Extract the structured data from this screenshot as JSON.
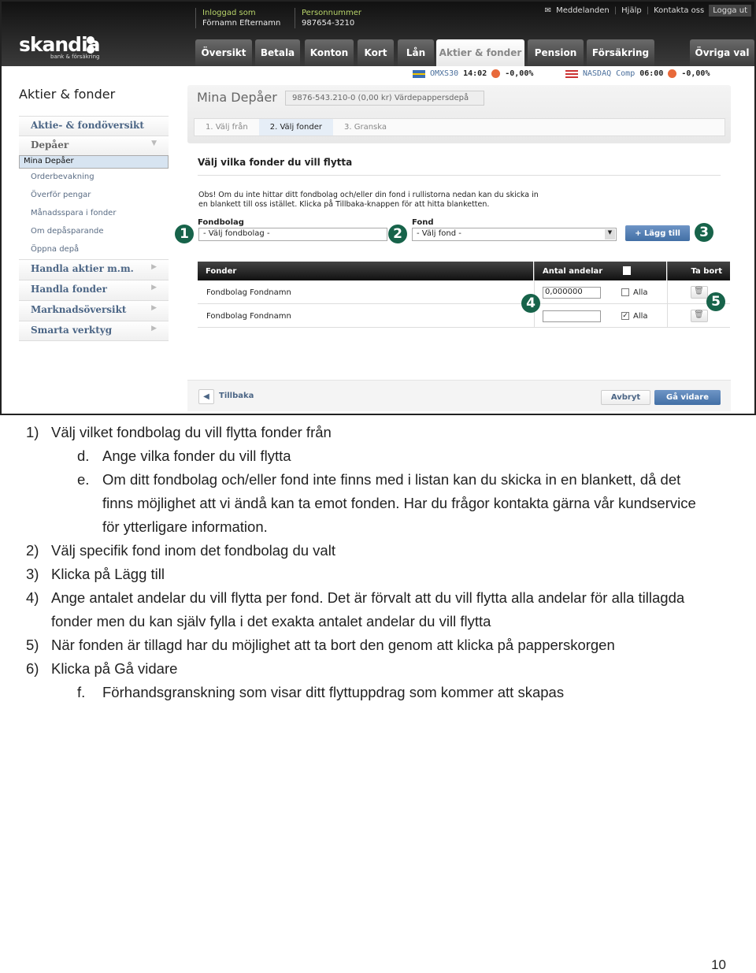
{
  "header": {
    "brand": "skandia",
    "brand_sub": "bank & försäkring",
    "logged_in_label": "Inloggad som",
    "logged_in_name": "Förnamn Efternamn",
    "pnr_label": "Personnummer",
    "pnr_value": "987654-3210",
    "top_links": [
      "Meddelanden",
      "Hjälp",
      "Kontakta oss"
    ],
    "logout": "Logga ut",
    "tabs": [
      "Översikt",
      "Betala",
      "Konton",
      "Kort",
      "Lån",
      "Aktier & fonder",
      "Pension",
      "Försäkring",
      "Övriga val"
    ],
    "active_tab": "Aktier & fonder"
  },
  "ticker": [
    {
      "name": "OMXS30",
      "time": "14:02",
      "change": "-0,00%"
    },
    {
      "name": "NASDAQ Comp",
      "time": "06:00",
      "change": "-0,00%"
    }
  ],
  "sidebar": {
    "title": "Aktier & fonder",
    "overview": "Aktie- & fondöversikt",
    "depaer": "Depåer",
    "sub": [
      "Mina Depåer",
      "Orderbevakning",
      "Överför pengar",
      "Månadsspara i fonder",
      "Om depåsparande",
      "Öppna depå"
    ],
    "sections": [
      "Handla aktier m.m.",
      "Handla fonder",
      "Marknadsöversikt",
      "Smarta verktyg"
    ]
  },
  "main": {
    "title": "Mina Depåer",
    "account": "9876-543.210-0 (0,00 kr) Värdepappersdepå",
    "steps": [
      "1. Välj från",
      "2. Välj fonder",
      "3. Granska"
    ],
    "heading": "Välj vilka fonder du vill flytta",
    "obs_line1": "Obs! Om du inte hittar ditt fondbolag och/eller din fond i rullistorna nedan kan du skicka in",
    "obs_line2": "en blankett till oss istället. Klicka på Tillbaka-knappen för att hitta blanketten.",
    "fondbolag_label": "Fondbolag",
    "fondbolag_value": "- Välj fondbolag -",
    "fond_label": "Fond",
    "fond_value": "- Välj fond -",
    "add": "+  Lägg till",
    "table": {
      "headers": [
        "Fonder",
        "Antal andelar",
        "Ta bort"
      ],
      "rows": [
        {
          "name": "Fondbolag Fondnamn",
          "qty": "0,000000",
          "all": "Alla",
          "all_checked": false
        },
        {
          "name": "Fondbolag Fondnamn",
          "qty": "",
          "all": "Alla",
          "all_checked": true
        }
      ]
    },
    "back": "Tillbaka",
    "cancel": "Avbryt",
    "next": "Gå vidare",
    "callouts": [
      "1",
      "2",
      "3",
      "4",
      "5"
    ]
  },
  "doc": {
    "lines": [
      {
        "n": "1)",
        "t": "Välj vilket fondbolag du vill flytta fonder från"
      },
      {
        "n": "d.",
        "t": "Ange vilka fonder du vill flytta"
      },
      {
        "n": "e.",
        "t": "Om ditt fondbolag och/eller fond inte finns med i listan kan du skicka in en blankett, då det"
      },
      {
        "n": "",
        "t": "finns möjlighet att vi ändå kan ta emot fonden. Har du frågor kontakta gärna vår kundservice"
      },
      {
        "n": "",
        "t": "för ytterligare information."
      },
      {
        "n": "2)",
        "t": "Välj specifik fond inom det fondbolag du valt"
      },
      {
        "n": "3)",
        "t": "Klicka på Lägg till"
      },
      {
        "n": "4)",
        "t": "Ange antalet andelar du vill flytta per fond. Det är förvalt att du vill flytta alla andelar för alla tillagda"
      },
      {
        "n": "",
        "t": "fonder men du kan själv fylla i det exakta antalet andelar du vill flytta"
      },
      {
        "n": "5)",
        "t": "När fonden är tillagd har du möjlighet att ta bort den genom att klicka på papperskorgen"
      },
      {
        "n": "6)",
        "t": "Klicka på Gå vidare"
      },
      {
        "n": "f.",
        "t": "Förhandsgranskning som visar ditt flyttuppdrag som kommer att skapas"
      }
    ],
    "page_number": "10"
  }
}
